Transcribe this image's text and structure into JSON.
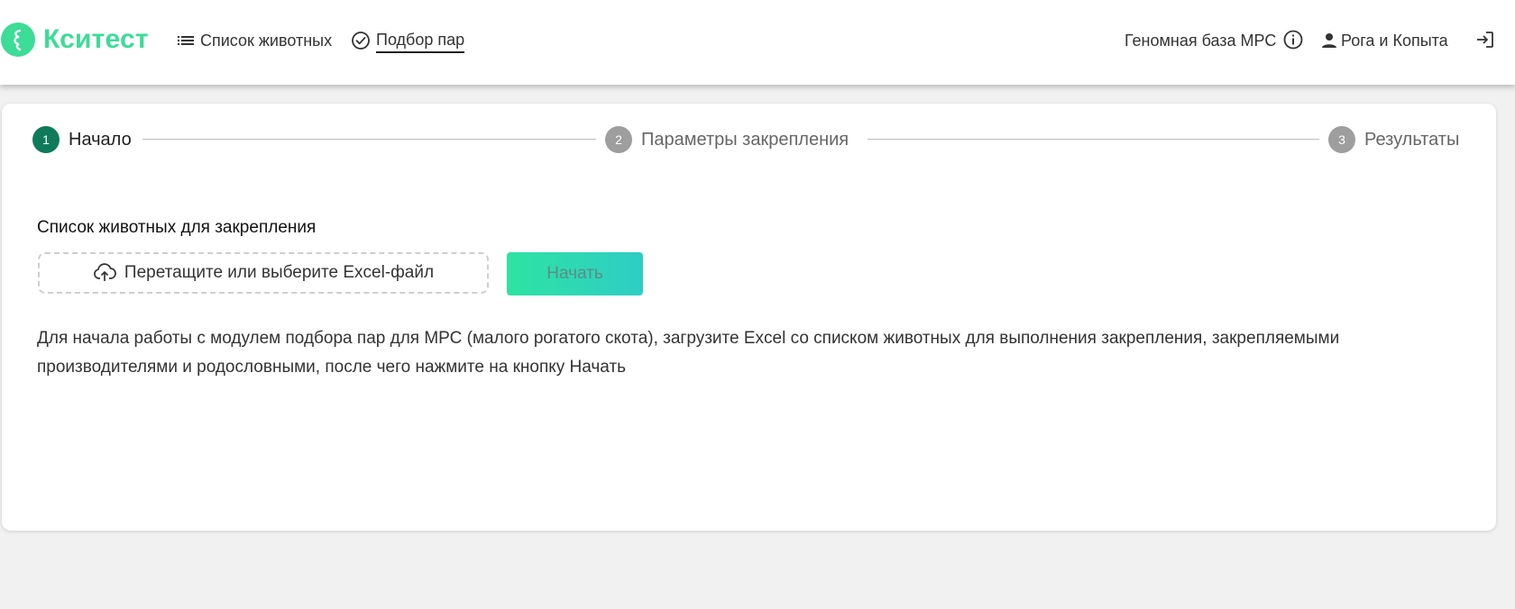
{
  "header": {
    "logo_text": "Кситест",
    "nav": [
      {
        "label": "Список животных",
        "icon": "list-icon"
      },
      {
        "label": "Подбор пар",
        "icon": "check-circle-icon",
        "active": true
      }
    ],
    "genome_link": "Геномная база МРС",
    "user_name": "Рога и Копыта"
  },
  "stepper": {
    "steps": [
      {
        "number": "1",
        "label": "Начало",
        "active": true
      },
      {
        "number": "2",
        "label": "Параметры закрепления",
        "active": false
      },
      {
        "number": "3",
        "label": "Результаты",
        "active": false
      }
    ]
  },
  "main": {
    "section_title": "Список животных для закрепления",
    "upload_label": "Перетащите или выберите Excel-файл",
    "start_label": "Начать",
    "description": "Для начала работы с модулем подбора пар для МРС (малого рогатого скота), загрузите Excel со списком животных для выполнения закрепления, закрепляемыми производителями и родословными, после чего нажмите на кнопку Начать"
  },
  "colors": {
    "brand": "#3ddc97",
    "active_step": "#0f7a5a",
    "inactive_step": "#9e9e9e",
    "button_gradient_start": "#2ee3a2",
    "button_gradient_end": "#2ecdc5"
  }
}
